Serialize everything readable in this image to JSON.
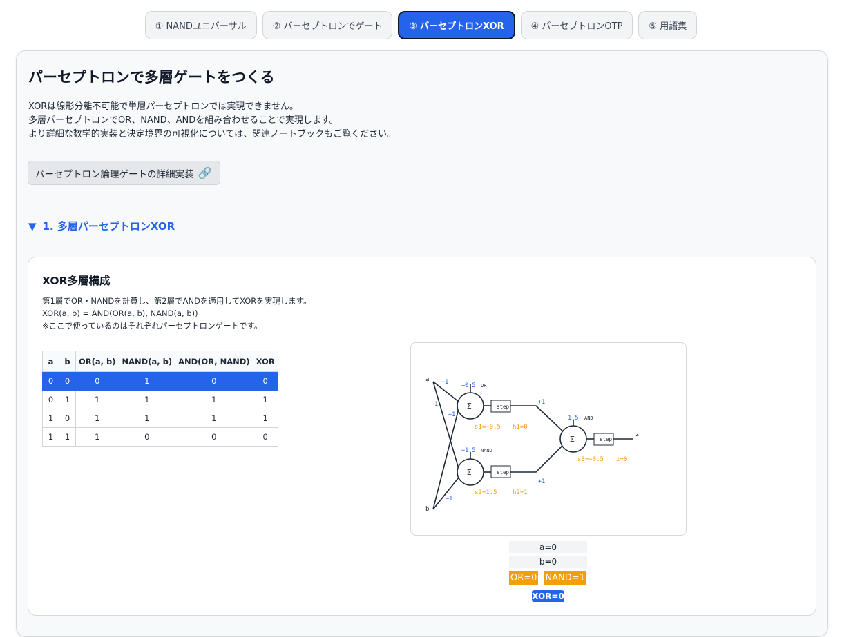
{
  "tabs": [
    {
      "label": "① NANDユニバーサル",
      "active": false
    },
    {
      "label": "② パーセプトロンでゲート",
      "active": false
    },
    {
      "label": "③ パーセプトロンXOR",
      "active": true
    },
    {
      "label": "④ パーセプトロンOTP",
      "active": false
    },
    {
      "label": "⑤ 用語集",
      "active": false
    }
  ],
  "page": {
    "title": "パーセプトロンで多層ゲートをつくる",
    "intro": [
      "XORは線形分離不可能で単層パーセプトロンでは実現できません。",
      "多層パーセプトロンでOR、NAND、ANDを組み合わせることで実現します。",
      "より詳細な数学的実装と決定境界の可視化については、関連ノートブックもご覧ください。"
    ],
    "link_label": "パーセプトロン論理ゲートの詳細実装",
    "link_icon": "link-icon"
  },
  "section": {
    "label": "1. 多層パーセプトロンXOR",
    "expanded": true,
    "icon": "triangle-down-icon"
  },
  "card": {
    "title": "XOR多層構成",
    "desc": [
      "第1層でOR・NANDを計算し、第2層でANDを適用してXORを実現します。",
      "XOR(a, b) = AND(OR(a, b), NAND(a, b))",
      "※ここで使っているのはそれぞれパーセプトロンゲートです。"
    ],
    "table": {
      "headers": [
        "a",
        "b",
        "OR(a, b)",
        "NAND(a, b)",
        "AND(OR, NAND)",
        "XOR"
      ],
      "rows": [
        [
          "0",
          "0",
          "0",
          "1",
          "0",
          "0"
        ],
        [
          "0",
          "1",
          "1",
          "1",
          "1",
          "1"
        ],
        [
          "1",
          "0",
          "1",
          "1",
          "1",
          "1"
        ],
        [
          "1",
          "1",
          "1",
          "0",
          "0",
          "0"
        ]
      ],
      "selected_row": 0
    },
    "diagram": {
      "input_a": "a",
      "input_b": "b",
      "output": "z",
      "w_a_or": "+1",
      "w_a_nand": "−1",
      "w_b_or": "+1",
      "w_b_nand": "−1",
      "or_bias": "−0.5",
      "or_name": "OR",
      "nand_bias": "+1.5",
      "nand_name": "NAND",
      "and_bias": "−1.5",
      "and_name": "AND",
      "w_h1_and": "+1",
      "w_h2_and": "+1",
      "sigma": "Σ",
      "step": "step",
      "s1": "s1=−0.5",
      "h1": "h1=0",
      "s2": "s2=1.5",
      "h2": "h2=1",
      "s3": "s3=−0.5",
      "z": "z=0",
      "colors": {
        "line": "#1f2937",
        "weight": "#2563eb",
        "value": "#f59e0b"
      }
    },
    "state": {
      "a": "a=0",
      "b": "b=0",
      "or": "OR=0",
      "nand": "NAND=1",
      "xor": "XOR=0"
    }
  },
  "colors": {
    "accent": "#2563eb",
    "highlight": "#f59e0b",
    "panel_bg": "#f8f9fb"
  }
}
